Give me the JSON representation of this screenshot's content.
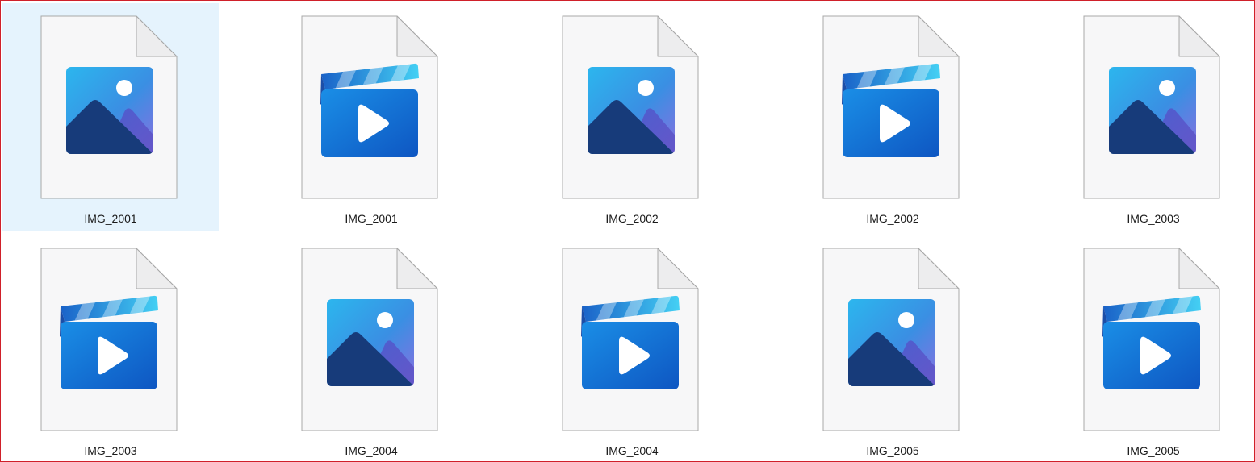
{
  "window": {
    "border_color": "#d0202a",
    "selection_color": "#e5f3fd"
  },
  "files": [
    {
      "name": "IMG_2001",
      "type": "image",
      "icon": "image-file-icon",
      "selected": true
    },
    {
      "name": "IMG_2001",
      "type": "video",
      "icon": "video-file-icon",
      "selected": false
    },
    {
      "name": "IMG_2002",
      "type": "image",
      "icon": "image-file-icon",
      "selected": false
    },
    {
      "name": "IMG_2002",
      "type": "video",
      "icon": "video-file-icon",
      "selected": false
    },
    {
      "name": "IMG_2003",
      "type": "image",
      "icon": "image-file-icon",
      "selected": false
    },
    {
      "name": "IMG_2003",
      "type": "video",
      "icon": "video-file-icon",
      "selected": false
    },
    {
      "name": "IMG_2004",
      "type": "image",
      "icon": "image-file-icon",
      "selected": false
    },
    {
      "name": "IMG_2004",
      "type": "video",
      "icon": "video-file-icon",
      "selected": false
    },
    {
      "name": "IMG_2005",
      "type": "image",
      "icon": "image-file-icon",
      "selected": false
    },
    {
      "name": "IMG_2005",
      "type": "video",
      "icon": "video-file-icon",
      "selected": false
    }
  ]
}
